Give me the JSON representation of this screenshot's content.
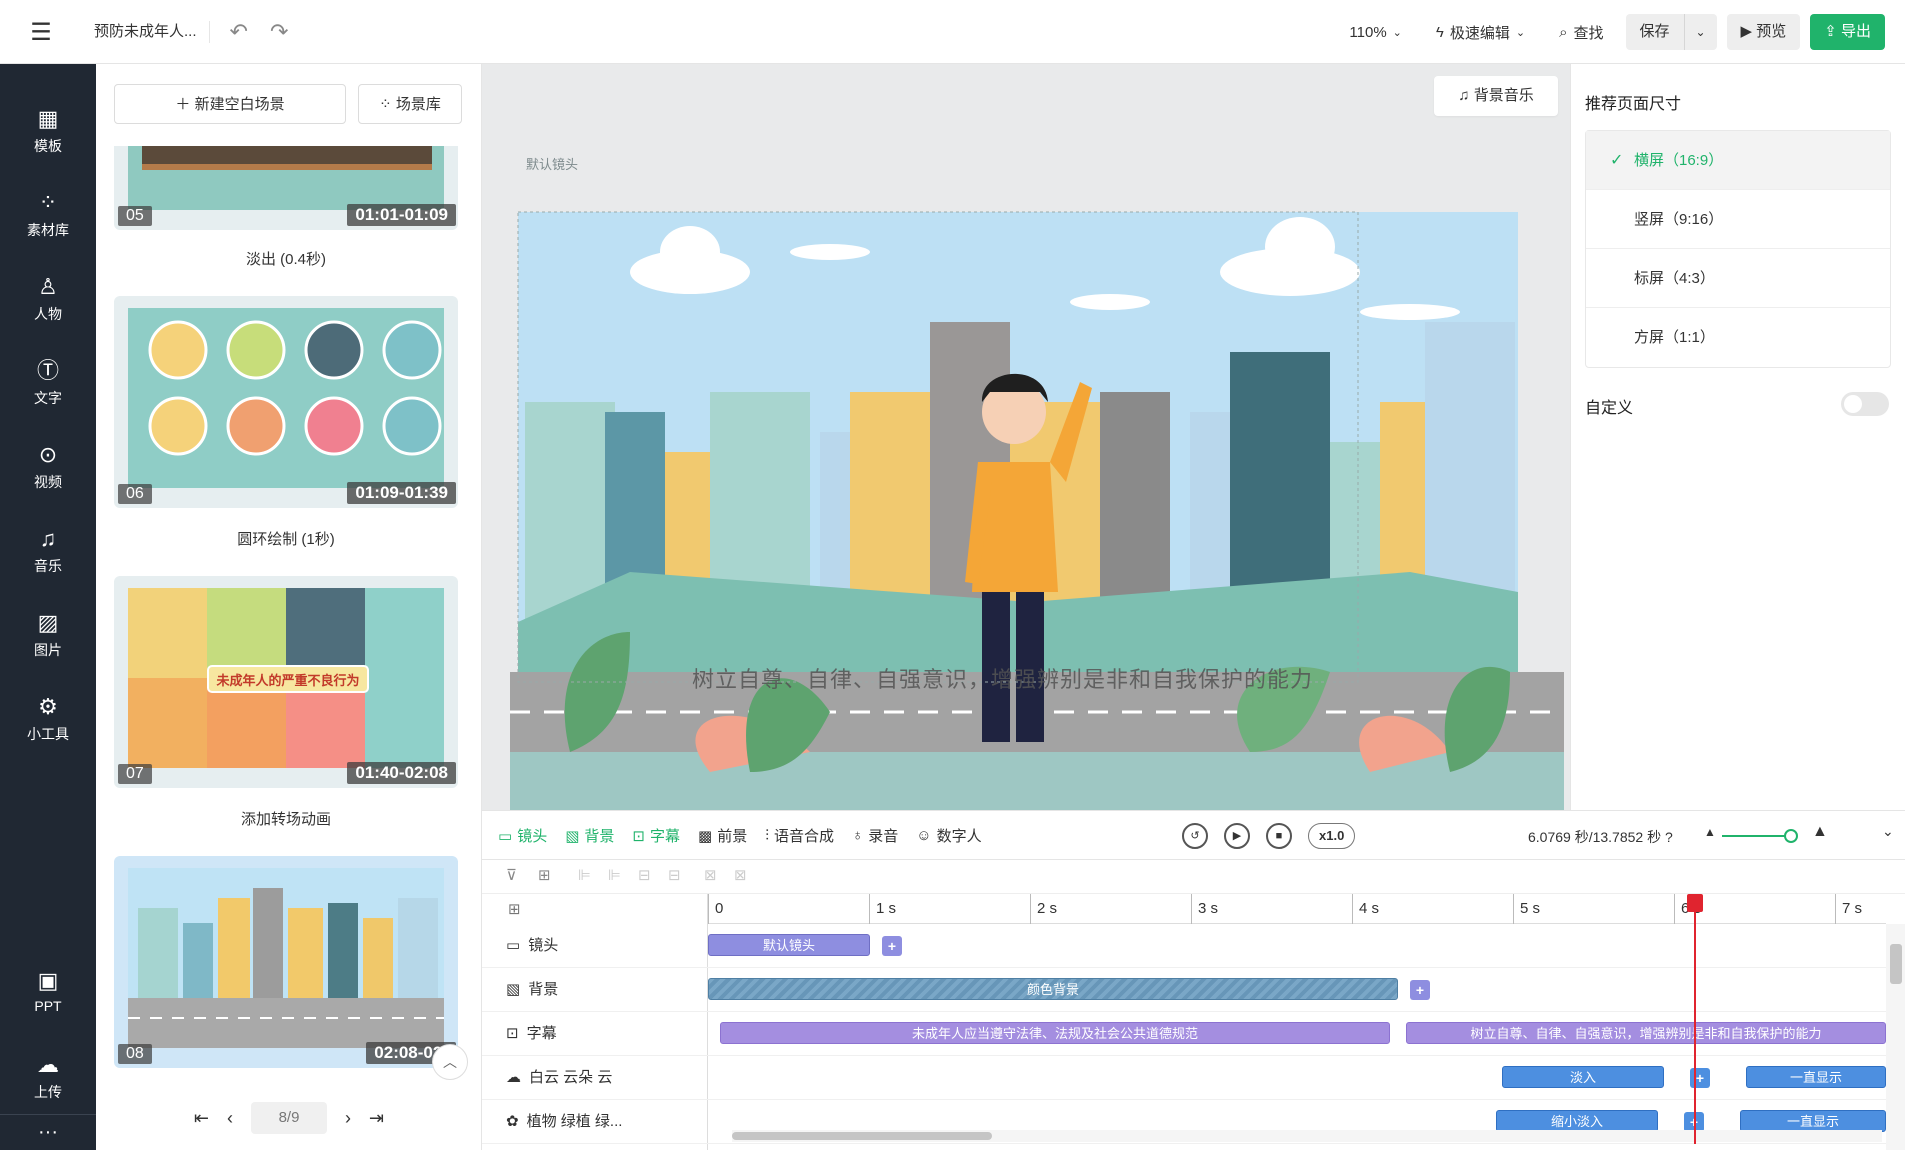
{
  "topbar": {
    "doc_title": "预防未成年人...",
    "zoom": "110%",
    "mode": "极速编辑",
    "find": "查找",
    "save": "保存",
    "preview": "预览",
    "export": "导出"
  },
  "sidebar": {
    "items": [
      {
        "label": "模板",
        "icon": "template-icon"
      },
      {
        "label": "素材库",
        "icon": "assets-icon"
      },
      {
        "label": "人物",
        "icon": "person-icon"
      },
      {
        "label": "文字",
        "icon": "text-icon"
      },
      {
        "label": "视频",
        "icon": "video-icon"
      },
      {
        "label": "音乐",
        "icon": "music-icon"
      },
      {
        "label": "图片",
        "icon": "image-icon"
      },
      {
        "label": "小工具",
        "icon": "tools-icon"
      },
      {
        "label": "PPT",
        "icon": "ppt-icon"
      },
      {
        "label": "上传",
        "icon": "upload-icon"
      }
    ],
    "more": "···"
  },
  "scenes": {
    "new_blank": "新建空白场景",
    "library": "场景库",
    "cards": [
      {
        "num": "05",
        "time": "01:01-01:09",
        "transition": "淡出 (0.4秒)"
      },
      {
        "num": "06",
        "time": "01:09-01:39",
        "transition": "圆环绘制 (1秒)"
      },
      {
        "num": "07",
        "time": "01:40-02:08",
        "transition": "添加转场动画"
      },
      {
        "num": "08",
        "time": "02:08-02:"
      }
    ],
    "pager": "8/9",
    "scene07_banner": "未成年人的严重不良行为"
  },
  "canvas": {
    "bg_music": "背景音乐",
    "camera_label": "默认镜头",
    "subtitle": "树立自尊、自律、自强意识，增强辨别是非和自我保护的能力"
  },
  "right_panel": {
    "title": "推荐页面尺寸",
    "sizes": [
      "横屏（16:9）",
      "竖屏（9:16）",
      "标屏（4:3）",
      "方屏（1:1）"
    ],
    "selected": 0,
    "custom_label": "自定义",
    "custom_enabled": false
  },
  "timeline": {
    "tabs": [
      "镜头",
      "背景",
      "字幕",
      "前景",
      "语音合成",
      "录音",
      "数字人"
    ],
    "speed": "x1.0",
    "time": "6.0769 秒/13.7852 秒",
    "ruler": [
      "0",
      "1 s",
      "2 s",
      "3 s",
      "4 s",
      "5 s",
      "6 s",
      "7 s"
    ],
    "rows": [
      {
        "label": "镜头",
        "segments": [
          "默认镜头"
        ]
      },
      {
        "label": "背景",
        "segments": [
          "颜色背景"
        ]
      },
      {
        "label": "字幕",
        "segments": [
          "未成年人应当遵守法律、法规及社会公共道德规范",
          "树立自尊、自律、自强意识，增强辨别是非和自我保护的能力"
        ]
      },
      {
        "label": "白云 云朵 云",
        "segments": [
          "淡入",
          "一直显示"
        ]
      },
      {
        "label": "植物 绿植 绿...",
        "segments": [
          "缩小淡入",
          "一直显示"
        ]
      }
    ],
    "playhead_seconds": 6.0769
  }
}
